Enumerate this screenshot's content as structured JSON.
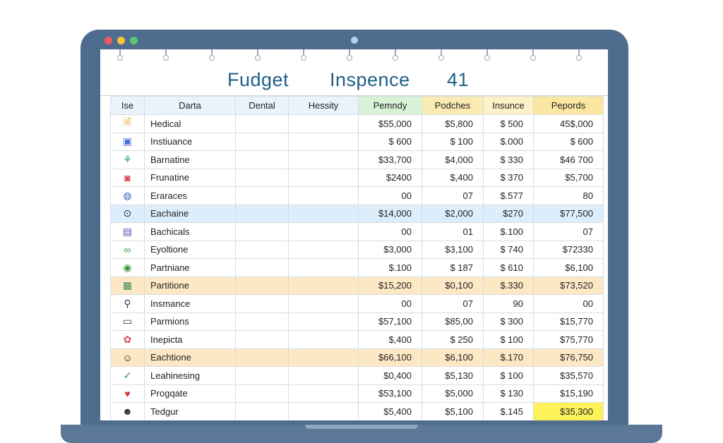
{
  "window": {
    "traffic_lights": [
      "#ee5b5b",
      "#f5c542",
      "#5cc86c"
    ]
  },
  "title": {
    "word1": "Fudget",
    "word2": "Inspence",
    "number": "41"
  },
  "columns": [
    "Ise",
    "Darta",
    "Dental",
    "Hessity",
    "Pemndy",
    "Podches",
    "Insunce",
    "Pepords"
  ],
  "rows": [
    {
      "icon": "document-icon",
      "glyph": "🗎",
      "color": "#e0a020",
      "name": "Hedical",
      "c1": "",
      "c2": "",
      "v1": "$55,000",
      "v2": "$5,800",
      "v3": "$ 500",
      "v4": "45$,000",
      "hl": ""
    },
    {
      "icon": "image-icon",
      "glyph": "▣",
      "color": "#4a6fd8",
      "name": "Instiuance",
      "c1": "",
      "c2": "",
      "v1": "$ 600",
      "v2": "$ 100",
      "v3": "$.000",
      "v4": "$ 600",
      "hl": ""
    },
    {
      "icon": "plant-icon",
      "glyph": "⚘",
      "color": "#2aa56a",
      "name": "Barnatine",
      "c1": "",
      "c2": "",
      "v1": "$33,700",
      "v2": "$4,000",
      "v3": "$ 330",
      "v4": "$46 700",
      "hl": ""
    },
    {
      "icon": "camera-icon",
      "glyph": "◙",
      "color": "#d83a4a",
      "name": "Frunatine",
      "c1": "",
      "c2": "",
      "v1": "$2400",
      "v2": "$,400",
      "v3": "$ 370",
      "v4": "$5,700",
      "hl": ""
    },
    {
      "icon": "globe-icon",
      "glyph": "◍",
      "color": "#3a62c8",
      "name": "Eraraces",
      "c1": "",
      "c2": "",
      "v1": "00",
      "v2": "07",
      "v3": "$.577",
      "v4": "80",
      "hl": ""
    },
    {
      "icon": "play-icon",
      "glyph": "⊙",
      "color": "#333333",
      "name": "Eachaine",
      "c1": "",
      "c2": "",
      "v1": "$14,000",
      "v2": "$2,000",
      "v3": "$270",
      "v4": "$77,500",
      "hl": "blue"
    },
    {
      "icon": "book-icon",
      "glyph": "▤",
      "color": "#5a4ab8",
      "name": "Bachicals",
      "c1": "",
      "c2": "",
      "v1": "00",
      "v2": "01",
      "v3": "$.100",
      "v4": "07",
      "hl": ""
    },
    {
      "icon": "link-icon",
      "glyph": "∞",
      "color": "#3a9a3a",
      "name": "Eyoltione",
      "c1": "",
      "c2": "",
      "v1": "$3,000",
      "v2": "$3,100",
      "v3": "$ 740",
      "v4": "$72330",
      "hl": ""
    },
    {
      "icon": "check-circle-icon",
      "glyph": "◉",
      "color": "#3a9a3a",
      "name": "Partniane",
      "c1": "",
      "c2": "",
      "v1": "$.100",
      "v2": "$ 187",
      "v3": "$ 610",
      "v4": "$6,100",
      "hl": ""
    },
    {
      "icon": "grid-icon",
      "glyph": "▦",
      "color": "#3a8a5a",
      "name": "Partitione",
      "c1": "",
      "c2": "",
      "v1": "$15,200",
      "v2": "$0,100",
      "v3": "$.330",
      "v4": "$73,520",
      "hl": "orange"
    },
    {
      "icon": "search-icon",
      "glyph": "⚲",
      "color": "#2a3a6a",
      "name": "Insmance",
      "c1": "",
      "c2": "",
      "v1": "00",
      "v2": "07",
      "v3": "90",
      "v4": "00",
      "hl": ""
    },
    {
      "icon": "monitor-icon",
      "glyph": "▭",
      "color": "#2a3a4a",
      "name": "Parmions",
      "c1": "",
      "c2": "",
      "v1": "$57,100",
      "v2": "$85,00",
      "v3": "$ 300",
      "v4": "$15,770",
      "hl": ""
    },
    {
      "icon": "flower-icon",
      "glyph": "✿",
      "color": "#d84a5a",
      "name": "Inepicta",
      "c1": "",
      "c2": "",
      "v1": "$,400",
      "v2": "$ 250",
      "v3": "$ 100",
      "v4": "$75,770",
      "hl": ""
    },
    {
      "icon": "smile-icon",
      "glyph": "☺",
      "color": "#2a2a2a",
      "name": "Eachtione",
      "c1": "",
      "c2": "",
      "v1": "$66,100",
      "v2": "$6,100",
      "v3": "$.170",
      "v4": "$76,750",
      "hl": "orange"
    },
    {
      "icon": "checkmark-icon",
      "glyph": "✓",
      "color": "#2a9a4a",
      "name": "Leahinesing",
      "c1": "",
      "c2": "",
      "v1": "$0,400",
      "v2": "$5,130",
      "v3": "$ 100",
      "v4": "$35,570",
      "hl": ""
    },
    {
      "icon": "heart-icon",
      "glyph": "♥",
      "color": "#d8323a",
      "name": "Progqate",
      "c1": "",
      "c2": "",
      "v1": "$53,100",
      "v2": "$5,000",
      "v3": "$ 130",
      "v4": "$15,190",
      "hl": ""
    },
    {
      "icon": "user-circle-icon",
      "glyph": "☻",
      "color": "#2a2a2a",
      "name": "Tedgur",
      "c1": "",
      "c2": "",
      "v1": "$5,400",
      "v2": "$5,100",
      "v3": "$.145",
      "v4": "$35,300",
      "hl": "",
      "v4_hl": "yellow"
    }
  ]
}
